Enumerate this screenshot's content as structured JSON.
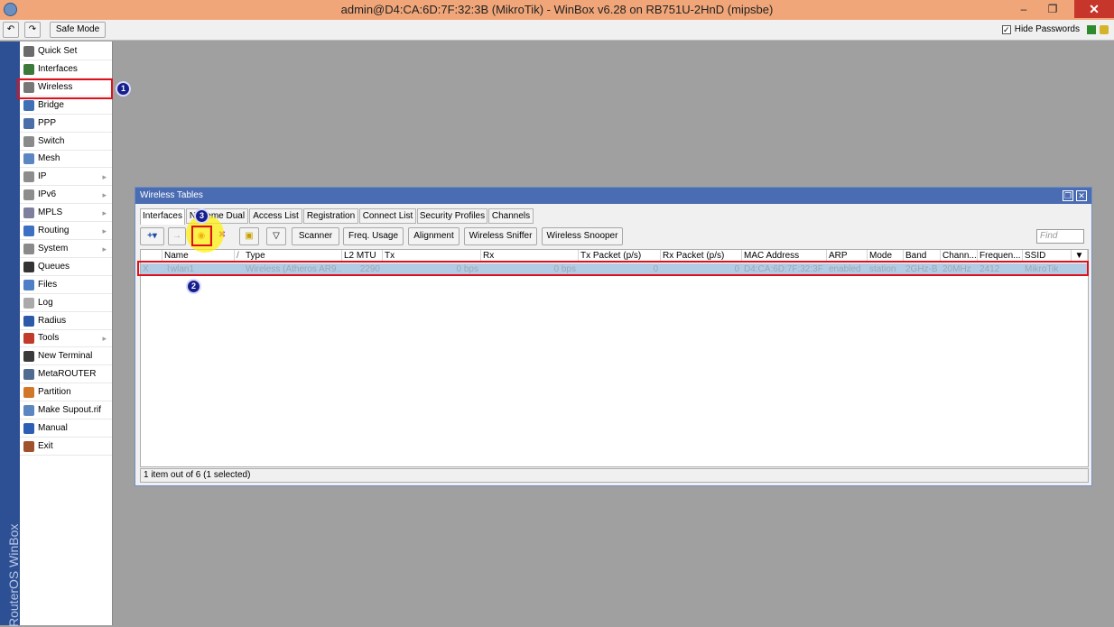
{
  "window": {
    "title": "admin@D4:CA:6D:7F:32:3B (MikroTik) - WinBox v6.28 on RB751U-2HnD (mipsbe)",
    "minimize": "–",
    "maximize": "❐",
    "close": "✕"
  },
  "toolbar": {
    "undo": "↶",
    "redo": "↷",
    "safe_mode": "Safe Mode",
    "hide_passwords": "Hide Passwords",
    "hide_passwords_checked": "✓"
  },
  "sidebar": {
    "brand": "RouterOS WinBox",
    "items": [
      {
        "label": "Quick Set",
        "icon": "wand-icon",
        "color": "#6b6b6b",
        "arrow": ""
      },
      {
        "label": "Interfaces",
        "icon": "interfaces-icon",
        "color": "#3c7a3c",
        "arrow": ""
      },
      {
        "label": "Wireless",
        "icon": "wireless-icon",
        "color": "#777777",
        "arrow": ""
      },
      {
        "label": "Bridge",
        "icon": "bridge-icon",
        "color": "#3f6fb5",
        "arrow": ""
      },
      {
        "label": "PPP",
        "icon": "ppp-icon",
        "color": "#4a6fa8",
        "arrow": ""
      },
      {
        "label": "Switch",
        "icon": "switch-icon",
        "color": "#8a8a8a",
        "arrow": ""
      },
      {
        "label": "Mesh",
        "icon": "mesh-icon",
        "color": "#5a86c2",
        "arrow": ""
      },
      {
        "label": "IP",
        "icon": "ip-icon",
        "color": "#8d8d8d",
        "arrow": "▸"
      },
      {
        "label": "IPv6",
        "icon": "ipv6-icon",
        "color": "#8d8d8d",
        "arrow": "▸"
      },
      {
        "label": "MPLS",
        "icon": "mpls-icon",
        "color": "#7e7e9e",
        "arrow": "▸"
      },
      {
        "label": "Routing",
        "icon": "routing-icon",
        "color": "#3d6fc2",
        "arrow": "▸"
      },
      {
        "label": "System",
        "icon": "system-icon",
        "color": "#8a8a8a",
        "arrow": "▸"
      },
      {
        "label": "Queues",
        "icon": "queues-icon",
        "color": "#333333",
        "arrow": ""
      },
      {
        "label": "Files",
        "icon": "files-icon",
        "color": "#4f7fc4",
        "arrow": ""
      },
      {
        "label": "Log",
        "icon": "log-icon",
        "color": "#aaaaaa",
        "arrow": ""
      },
      {
        "label": "Radius",
        "icon": "radius-icon",
        "color": "#2d5aa8",
        "arrow": ""
      },
      {
        "label": "Tools",
        "icon": "tools-icon",
        "color": "#c23a2a",
        "arrow": "▸"
      },
      {
        "label": "New Terminal",
        "icon": "terminal-icon",
        "color": "#3a3a3a",
        "arrow": ""
      },
      {
        "label": "MetaROUTER",
        "icon": "metarouter-icon",
        "color": "#4f6b8f",
        "arrow": ""
      },
      {
        "label": "Partition",
        "icon": "partition-icon",
        "color": "#d2772a",
        "arrow": ""
      },
      {
        "label": "Make Supout.rif",
        "icon": "supout-icon",
        "color": "#5b86c0",
        "arrow": ""
      },
      {
        "label": "Manual",
        "icon": "manual-icon",
        "color": "#2c5fb3",
        "arrow": ""
      },
      {
        "label": "Exit",
        "icon": "exit-icon",
        "color": "#a0522d",
        "arrow": ""
      }
    ]
  },
  "wireless_tables": {
    "title": "Wireless Tables",
    "restore": "❐",
    "close": "✕",
    "tabs": [
      "Interfaces",
      "Nstreme Dual",
      "Access List",
      "Registration",
      "Connect List",
      "Security Profiles",
      "Channels"
    ],
    "buttons": {
      "add": "+▾",
      "disable": "→",
      "enable": "◉",
      "remove": "✖",
      "comment": "▣",
      "filter": "▽",
      "scanner": "Scanner",
      "freq_usage": "Freq. Usage",
      "alignment": "Alignment",
      "wireless_sniffer": "Wireless Sniffer",
      "wireless_snooper": "Wireless Snooper"
    },
    "find_placeholder": "Find",
    "columns": [
      "Name",
      "/",
      "Type",
      "L2 MTU",
      "Tx",
      "Rx",
      "Tx Packet (p/s)",
      "Rx Packet (p/s)",
      "MAC Address",
      "ARP",
      "Mode",
      "Band",
      "Chann...",
      "Frequen...",
      "SSID"
    ],
    "column_menu": "▼",
    "rows": [
      {
        "flag": "X",
        "name": "⌇wlan1",
        "type": "Wireless (Atheros AR9...",
        "l2mtu": "2290",
        "tx": "0 bps",
        "rx": "0 bps",
        "tx_packet": "0",
        "rx_packet": "0",
        "mac": "D4:CA:6D:7F:32:3F",
        "arp": "enabled",
        "mode": "station",
        "band": "2GHz-B",
        "channel": "20MHz",
        "frequency": "2412",
        "ssid": "MikroTik"
      }
    ],
    "status": "1 item out of 6 (1 selected)"
  },
  "annotations": {
    "badge1": "1",
    "badge2": "2",
    "badge3": "3"
  },
  "colors": {
    "titlebar": "#f0a679",
    "highlight": "#e0101a",
    "selected_row": "#b3cce6",
    "window_title": "#4a6cb3"
  }
}
